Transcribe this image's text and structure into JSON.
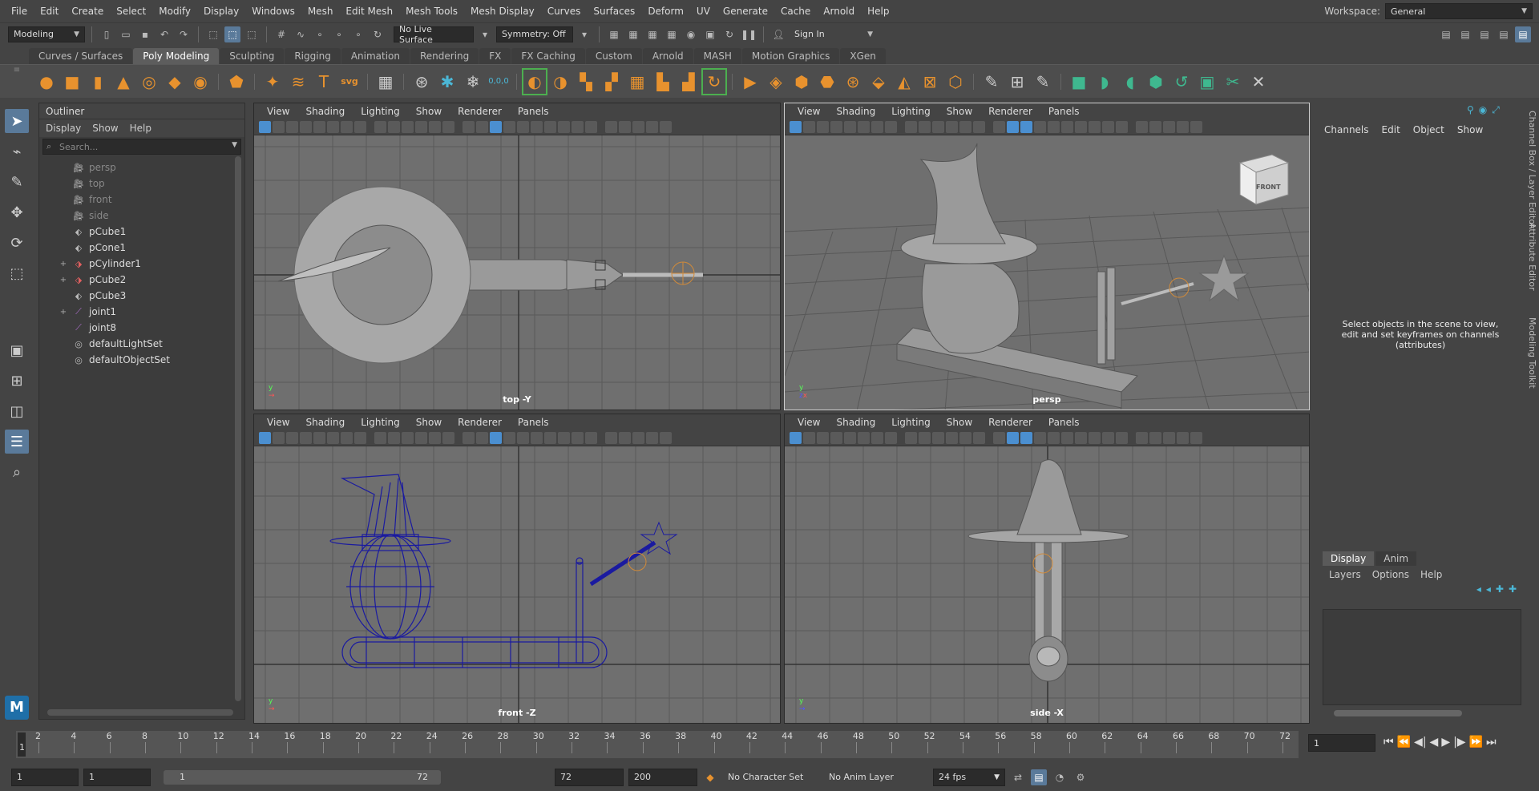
{
  "menubar": {
    "items": [
      "File",
      "Edit",
      "Create",
      "Select",
      "Modify",
      "Display",
      "Windows",
      "Mesh",
      "Edit Mesh",
      "Mesh Tools",
      "Mesh Display",
      "Curves",
      "Surfaces",
      "Deform",
      "UV",
      "Generate",
      "Cache",
      "Arnold",
      "Help"
    ],
    "workspace_label": "Workspace:",
    "workspace_value": "General"
  },
  "statusline": {
    "mode": "Modeling",
    "live_surface": "No Live Surface",
    "symmetry": "Symmetry: Off",
    "sign_in": "Sign In"
  },
  "shelf": {
    "tabs": [
      "Curves / Surfaces",
      "Poly Modeling",
      "Sculpting",
      "Rigging",
      "Animation",
      "Rendering",
      "FX",
      "FX Caching",
      "Custom",
      "Arnold",
      "MASH",
      "Motion Graphics",
      "XGen"
    ],
    "active_tab": "Poly Modeling",
    "svg_label": "svg",
    "text_label": "T",
    "coord_label": "0,0,0"
  },
  "outliner": {
    "title": "Outliner",
    "menu": [
      "Display",
      "Show",
      "Help"
    ],
    "search_placeholder": "Search...",
    "items": [
      {
        "name": "persp",
        "icon": "camera-icon",
        "dim": true,
        "expand": ""
      },
      {
        "name": "top",
        "icon": "camera-icon",
        "dim": true,
        "expand": ""
      },
      {
        "name": "front",
        "icon": "camera-icon",
        "dim": true,
        "expand": ""
      },
      {
        "name": "side",
        "icon": "camera-icon",
        "dim": true,
        "expand": ""
      },
      {
        "name": "pCube1",
        "icon": "mesh-icon",
        "dim": false,
        "expand": ""
      },
      {
        "name": "pCone1",
        "icon": "mesh-icon",
        "dim": false,
        "expand": ""
      },
      {
        "name": "pCylinder1",
        "icon": "skinned-mesh-icon",
        "dim": false,
        "expand": "+"
      },
      {
        "name": "pCube2",
        "icon": "skinned-mesh-icon",
        "dim": false,
        "expand": "+"
      },
      {
        "name": "pCube3",
        "icon": "mesh-icon",
        "dim": false,
        "expand": ""
      },
      {
        "name": "joint1",
        "icon": "joint-icon",
        "dim": false,
        "expand": "+"
      },
      {
        "name": "joint8",
        "icon": "joint-icon",
        "dim": false,
        "expand": ""
      },
      {
        "name": "defaultLightSet",
        "icon": "set-icon",
        "dim": false,
        "expand": ""
      },
      {
        "name": "defaultObjectSet",
        "icon": "set-icon",
        "dim": false,
        "expand": ""
      }
    ]
  },
  "panel_menu": [
    "View",
    "Shading",
    "Lighting",
    "Show",
    "Renderer",
    "Panels"
  ],
  "viewports": {
    "top": "top -Y",
    "persp": "persp",
    "front": "front -Z",
    "side": "side -X",
    "viewcube": "FRONT"
  },
  "channelbox": {
    "menu": [
      "Channels",
      "Edit",
      "Object",
      "Show"
    ],
    "message": "Select objects in the scene to view, edit and set keyframes on channels (attributes)",
    "side_tabs": [
      "Channel Box / Layer Editor",
      "Attribute Editor",
      "Modeling Toolkit"
    ],
    "layer_tabs": [
      "Display",
      "Anim"
    ],
    "layer_menu": [
      "Layers",
      "Options",
      "Help"
    ]
  },
  "timeline": {
    "ticks": [
      2,
      4,
      6,
      8,
      10,
      12,
      14,
      16,
      18,
      20,
      22,
      24,
      26,
      28,
      30,
      32,
      34,
      36,
      38,
      40,
      42,
      44,
      46,
      48,
      50,
      52,
      54,
      56,
      58,
      60,
      62,
      64,
      66,
      68,
      70,
      72
    ],
    "current_frame": "1",
    "start_marker": "1"
  },
  "range": {
    "start": "1",
    "anim_start": "1",
    "range_start": "1",
    "range_end": "72",
    "anim_end": "72",
    "end": "200",
    "character_set": "No Character Set",
    "anim_layer": "No Anim Layer",
    "fps": "24 fps"
  }
}
